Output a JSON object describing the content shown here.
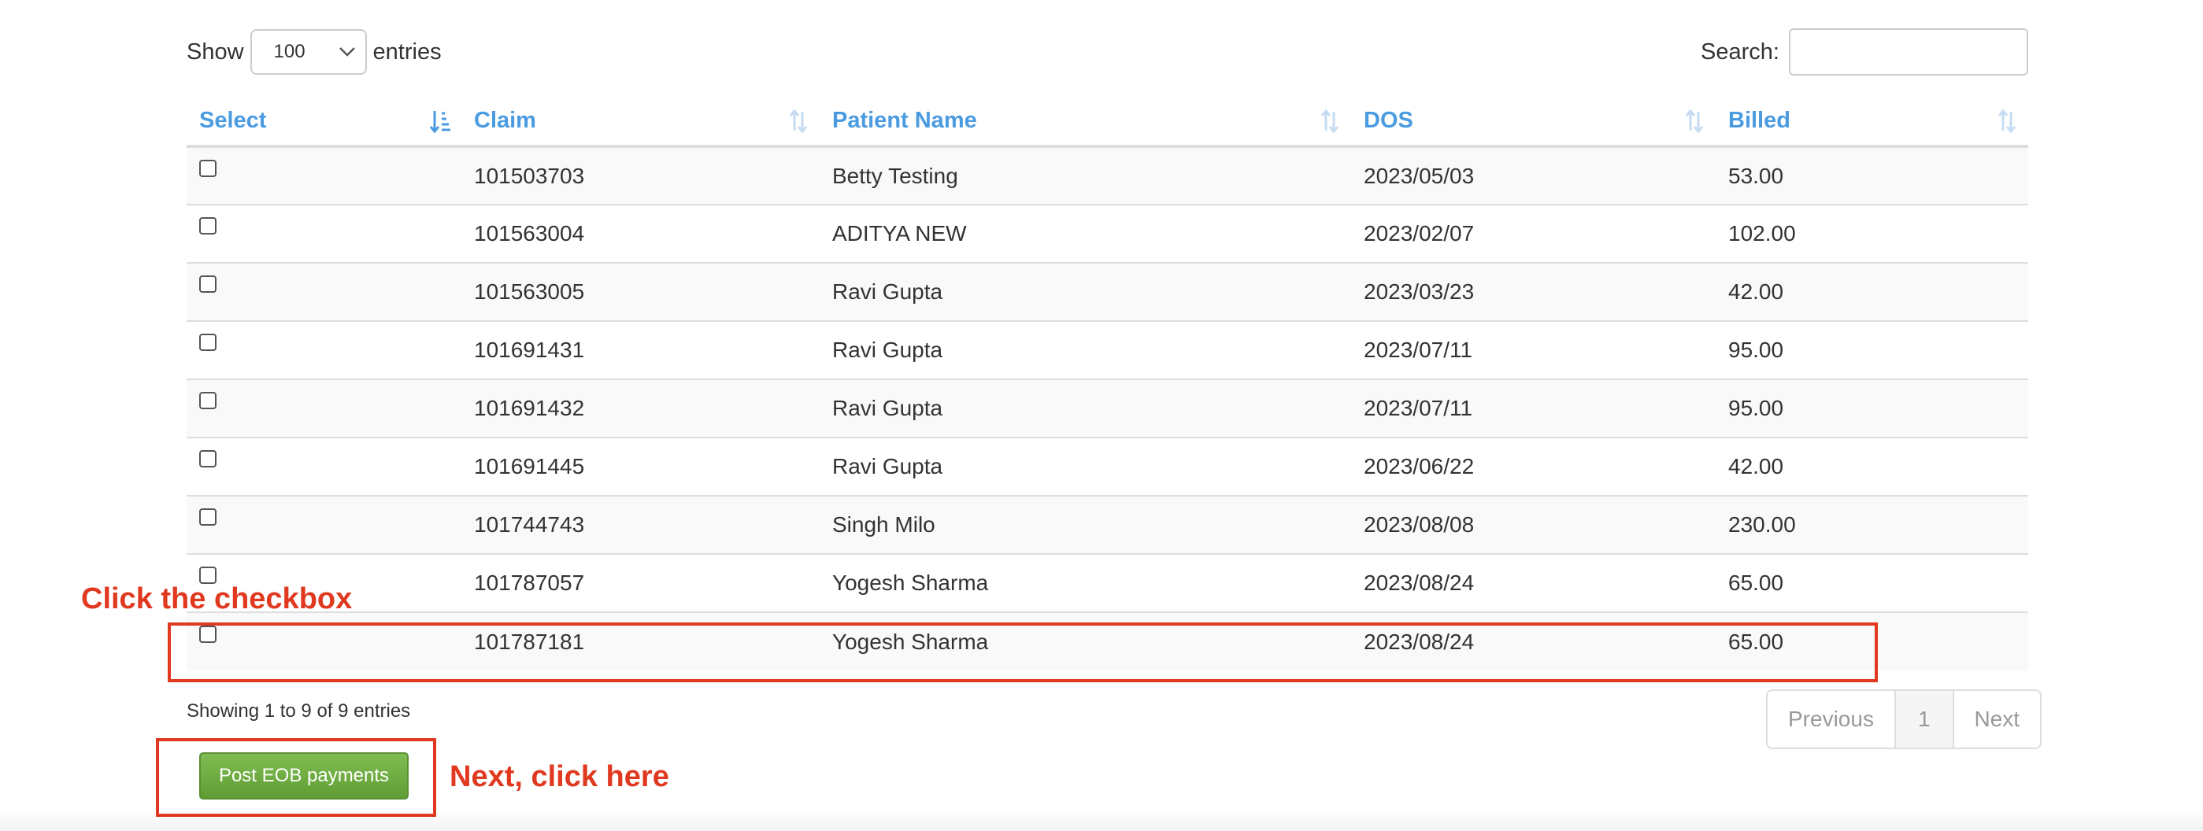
{
  "length_menu": {
    "show_label": "Show",
    "selected": "100",
    "entries_label": "entries"
  },
  "search": {
    "label": "Search:",
    "value": "",
    "placeholder": ""
  },
  "table": {
    "columns": [
      "Select",
      "Claim",
      "Patient Name",
      "DOS",
      "Billed"
    ],
    "rows": [
      {
        "claim": "101503703",
        "patient": "Betty Testing",
        "dos": "2023/05/03",
        "billed": "53.00"
      },
      {
        "claim": "101563004",
        "patient": "ADITYA NEW",
        "dos": "2023/02/07",
        "billed": "102.00"
      },
      {
        "claim": "101563005",
        "patient": "Ravi Gupta",
        "dos": "2023/03/23",
        "billed": "42.00"
      },
      {
        "claim": "101691431",
        "patient": "Ravi Gupta",
        "dos": "2023/07/11",
        "billed": "95.00"
      },
      {
        "claim": "101691432",
        "patient": "Ravi Gupta",
        "dos": "2023/07/11",
        "billed": "95.00"
      },
      {
        "claim": "101691445",
        "patient": "Ravi Gupta",
        "dos": "2023/06/22",
        "billed": "42.00"
      },
      {
        "claim": "101744743",
        "patient": "Singh Milo",
        "dos": "2023/08/08",
        "billed": "230.00"
      },
      {
        "claim": "101787057",
        "patient": "Yogesh Sharma",
        "dos": "2023/08/24",
        "billed": "65.00"
      },
      {
        "claim": "101787181",
        "patient": "Yogesh Sharma",
        "dos": "2023/08/24",
        "billed": "65.00"
      }
    ]
  },
  "info": "Showing 1 to 9 of 9 entries",
  "pagination": {
    "previous": "Previous",
    "current": "1",
    "next": "Next"
  },
  "action": {
    "post_label": "Post EOB payments"
  },
  "annotations": {
    "checkbox_hint": "Click the checkbox",
    "button_hint": "Next, click here"
  },
  "colors": {
    "header_link": "#4a9be0",
    "annotation": "#e0391f",
    "button_green": "#6aa83e"
  },
  "icons": {
    "sort_active": "sort-asc-icon",
    "sort_inactive": "sort-both-icon",
    "dropdown": "chevron-down-icon"
  }
}
